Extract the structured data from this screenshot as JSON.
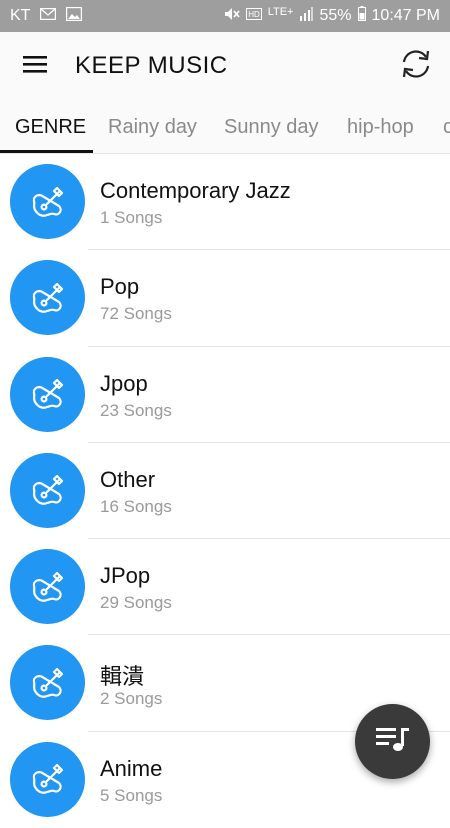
{
  "status_bar": {
    "carrier": "KT",
    "network": "LTE",
    "network_plus": "+",
    "battery": "55%",
    "time": "10:47 PM"
  },
  "app_bar": {
    "title": "KEEP MUSIC"
  },
  "tabs": [
    {
      "label": "GENRE",
      "active": true
    },
    {
      "label": "Rainy day",
      "active": false
    },
    {
      "label": "Sunny day",
      "active": false
    },
    {
      "label": "hip-hop",
      "active": false
    },
    {
      "label": "c",
      "active": false
    }
  ],
  "genres": [
    {
      "name": "Contemporary Jazz",
      "count": "1 Songs"
    },
    {
      "name": "Pop",
      "count": "72 Songs"
    },
    {
      "name": "Jpop",
      "count": "23 Songs"
    },
    {
      "name": "Other",
      "count": "16 Songs"
    },
    {
      "name": "JPop",
      "count": "29 Songs"
    },
    {
      "name": "輯潰",
      "count": "2 Songs"
    },
    {
      "name": "Anime",
      "count": "5 Songs"
    }
  ],
  "colors": {
    "accent": "#2196f3",
    "fab": "#3a3a3a",
    "status_bar": "#9e9e9e"
  },
  "icons": {
    "menu": "menu-icon",
    "sync": "sync-icon",
    "genre": "guitar-icon",
    "fab": "playlist-icon"
  }
}
